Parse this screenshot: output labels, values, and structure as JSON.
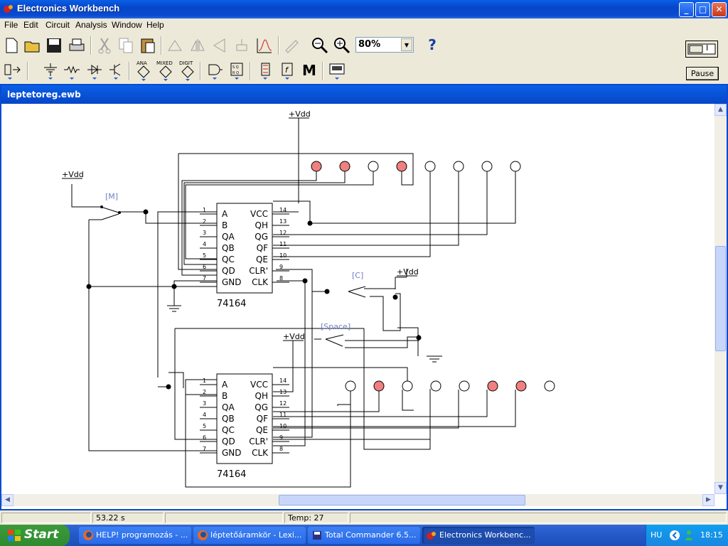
{
  "window": {
    "title": "Electronics Workbench",
    "minimize": "_",
    "maximize": "□",
    "close": "✕"
  },
  "menu": [
    "File",
    "Edit",
    "Circuit",
    "Analysis",
    "Window",
    "Help"
  ],
  "toolbar": {
    "zoom_value": "80%",
    "help_label": "?",
    "pause_label": "Pause",
    "power_label": "I",
    "bin_labels": [
      "ANA",
      "MIXED",
      "DIGIT"
    ],
    "misc_label": "M"
  },
  "document": {
    "title": "leptetoreg.ewb"
  },
  "circuit": {
    "vdd_label": "+Vdd",
    "switch_m": "[M]",
    "switch_c": "[C]",
    "switch_space": "[Space]",
    "chip_name": "74164",
    "pins_left": [
      {
        "num": "1",
        "name": "A"
      },
      {
        "num": "2",
        "name": "B"
      },
      {
        "num": "3",
        "name": "QA"
      },
      {
        "num": "4",
        "name": "QB"
      },
      {
        "num": "5",
        "name": "QC"
      },
      {
        "num": "6",
        "name": "QD"
      },
      {
        "num": "7",
        "name": "GND"
      }
    ],
    "pins_right": [
      {
        "num": "14",
        "name": "VCC"
      },
      {
        "num": "13",
        "name": "QH"
      },
      {
        "num": "12",
        "name": "QG"
      },
      {
        "num": "11",
        "name": "QF"
      },
      {
        "num": "10",
        "name": "QE"
      },
      {
        "num": "9",
        "name": "CLR'"
      },
      {
        "num": "8",
        "name": "CLK"
      }
    ],
    "top_leds_lit": [
      true,
      true,
      false,
      true,
      false,
      false,
      false,
      false
    ],
    "bottom_leds_lit": [
      false,
      true,
      false,
      false,
      false,
      true,
      true,
      false
    ],
    "led_on_color": "#f08080"
  },
  "status": {
    "time": "53.22 s",
    "temp": "Temp:  27"
  },
  "taskbar": {
    "start": "Start",
    "tasks": [
      "HELP! programozás - ...",
      "léptetőáramkör - Lexi...",
      "Total Commander 6.5...",
      "Electronics Workbenc..."
    ],
    "lang": "HU",
    "clock": "18:15"
  }
}
